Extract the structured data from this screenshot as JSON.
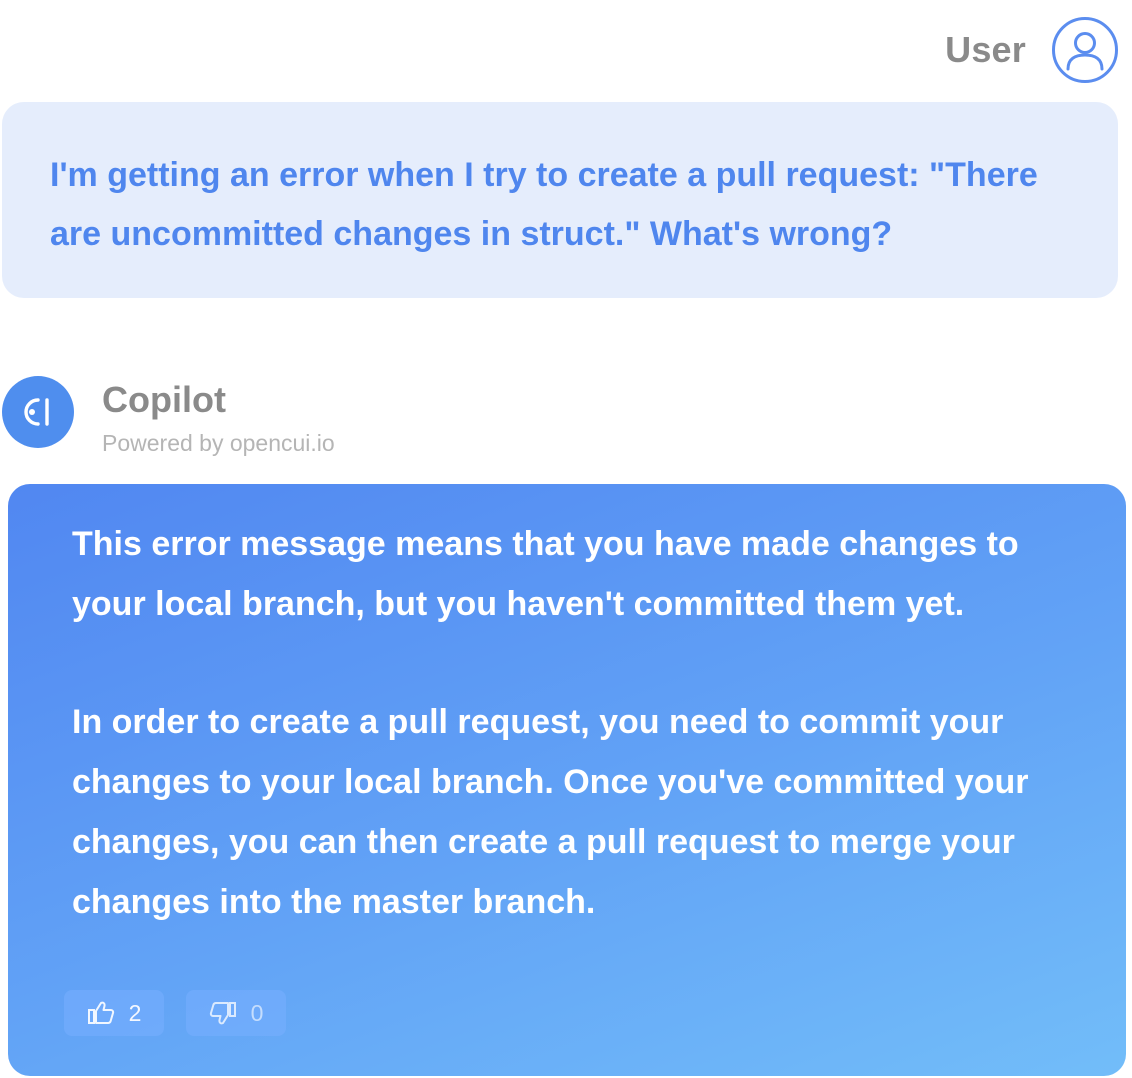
{
  "user": {
    "name": "User",
    "avatar_icon": "user-outline-icon",
    "message": "I'm getting an error when I try to create a pull request: \"There are uncommitted changes in struct.\" What's wrong?"
  },
  "bot": {
    "name": "Copilot",
    "powered_by": "Powered by opencui.io",
    "avatar_icon": "opencui-logo-icon",
    "paragraphs": [
      "This error message means that you have made changes to your local branch, but you haven't committed them yet.",
      "In order to create a pull request, you need to commit your changes to your local branch. Once you've committed your changes, you can then create a pull request to merge your changes into the master branch."
    ]
  },
  "feedback": {
    "like_icon": "thumbs-up-icon",
    "like_count": "2",
    "dislike_icon": "thumbs-down-icon",
    "dislike_count": "0"
  },
  "colors": {
    "accent": "#4f86ee",
    "user_bubble": "#e5edfc",
    "bot_gradient_start": "#5187f1",
    "bot_gradient_end": "#72bdf9",
    "name_gray": "#8a8a8a"
  }
}
